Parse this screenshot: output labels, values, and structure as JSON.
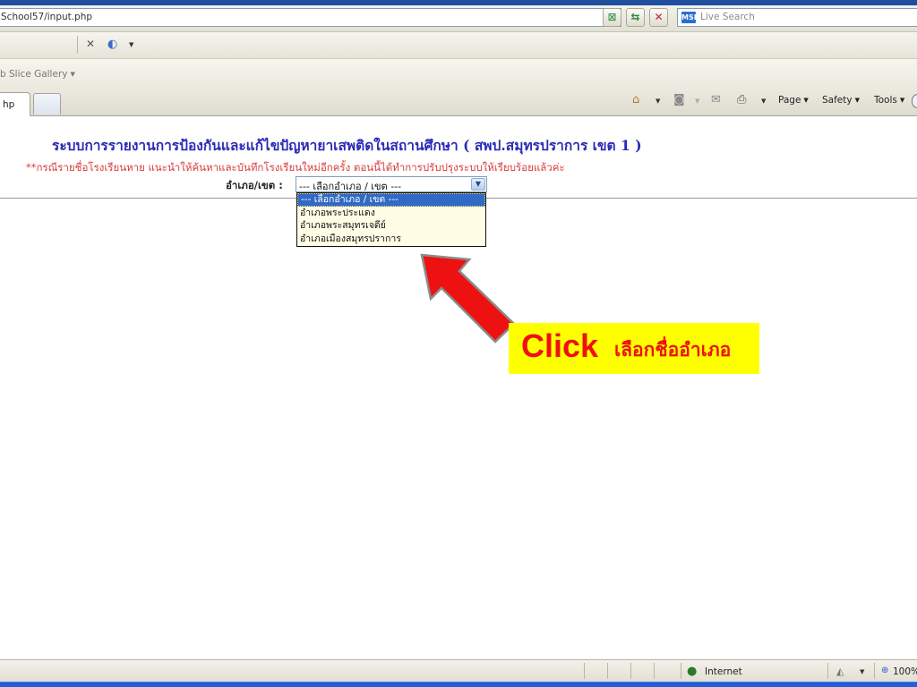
{
  "browser": {
    "address_url": "School57/input.php",
    "search_placeholder": "Live Search",
    "live_icon": "MSN",
    "favorites_bar_item": "b Slice Gallery",
    "tab_label": "hp",
    "commands": {
      "page": "Page",
      "safety": "Safety",
      "tools": "Tools"
    },
    "status": {
      "zone": "Internet",
      "zoom": "100%"
    },
    "icons": [
      "compat-view-icon",
      "refresh-icon",
      "stop-icon",
      "close-icon",
      "globe-icon",
      "home-icon",
      "feeds-icon",
      "mail-icon",
      "print-icon",
      "help-icon",
      "protected-mode-icon",
      "zoom-icon"
    ]
  },
  "page": {
    "heading": "ระบบการรายงานการป้องกันและแก้ไขปัญหายาเสพติดในสถานศึกษา ( สพป.สมุทรปราการ เขต 1 )",
    "notice": "**กรณีรายชื่อโรงเรียนหาย แนะนำให้ค้นหาและบันทึกโรงเรียนใหม่อีกครั้ง ตอนนี้ได้ทำการปรับปรุงระบบให้เรียบร้อยแล้วค่ะ",
    "district_label": "อำเภอ/เขต :",
    "district_select": {
      "selected": "--- เลือกอำเภอ / เขต ---",
      "options": [
        "--- เลือกอำเภอ / เขต ---",
        "อำเภอพระประแดง",
        "อำเภอพระสมุทรเจดีย์",
        "อำเภอเมืองสมุทรปราการ"
      ]
    }
  },
  "annotation": {
    "click_word": "Click",
    "instruction": "เลือกชื่ออำเภอ",
    "arrow_color": "#ee1111",
    "callout_bg": "#ffff00"
  }
}
